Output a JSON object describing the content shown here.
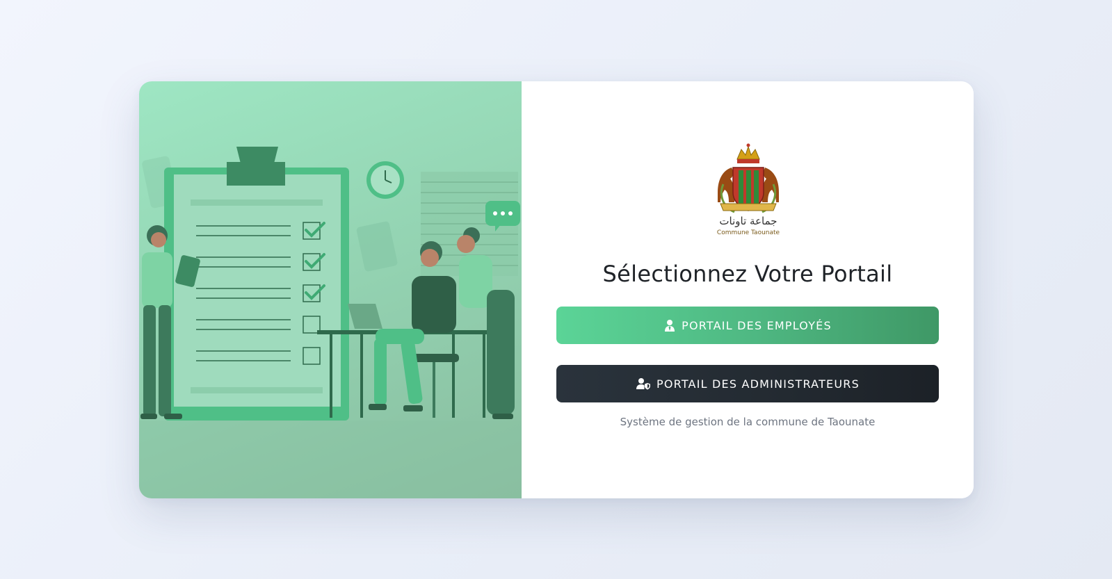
{
  "portal": {
    "title": "Sélectionnez Votre Portail",
    "employee_button_label": "PORTAIL DES EMPLOYÉS",
    "admin_button_label": "PORTAIL DES ADMINISTRATEURS",
    "footer": "Système de gestion de la commune de Taounate"
  },
  "logo": {
    "arabic_text": "جماعة تاونات",
    "latin_text": "Commune Taounate"
  },
  "colors": {
    "accent_green": "#4fb983",
    "dark_button": "#232a31"
  },
  "icons": {
    "employee": "user-tie-icon",
    "admin": "user-shield-icon"
  }
}
